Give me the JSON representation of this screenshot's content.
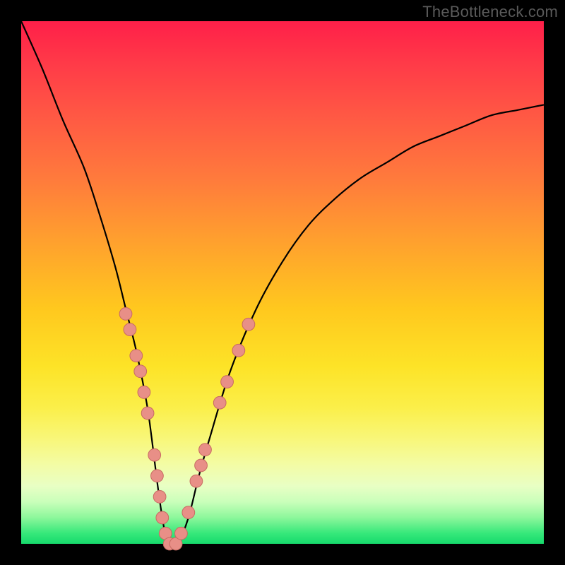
{
  "watermark": "TheBottleneck.com",
  "colors": {
    "frame": "#000000",
    "curve": "#000000",
    "marker_fill": "#e88f87",
    "marker_stroke": "#c76b62",
    "gradient_top": "#ff1f49",
    "gradient_bottom": "#16da6c"
  },
  "chart_data": {
    "type": "line",
    "title": "",
    "xlabel": "",
    "ylabel": "",
    "xlim": [
      0,
      100
    ],
    "ylim": [
      0,
      100
    ],
    "grid": false,
    "legend": false,
    "annotations": [],
    "series": [
      {
        "name": "bottleneck-curve",
        "x": [
          0,
          4,
          8,
          12,
          15,
          18,
          20,
          22,
          24,
          25,
          26,
          27,
          28,
          29,
          30,
          32,
          34,
          36,
          40,
          45,
          50,
          55,
          60,
          65,
          70,
          75,
          80,
          85,
          90,
          95,
          100
        ],
        "y": [
          100,
          91,
          81,
          72,
          63,
          53,
          45,
          37,
          27,
          20,
          12,
          5,
          0,
          0,
          0,
          5,
          13,
          20,
          33,
          45,
          54,
          61,
          66,
          70,
          73,
          76,
          78,
          80,
          82,
          83,
          84
        ]
      }
    ],
    "markers": [
      {
        "series": "bottleneck-curve",
        "x": 20.0,
        "y": 44
      },
      {
        "series": "bottleneck-curve",
        "x": 20.8,
        "y": 41
      },
      {
        "series": "bottleneck-curve",
        "x": 22.0,
        "y": 36
      },
      {
        "series": "bottleneck-curve",
        "x": 22.8,
        "y": 33
      },
      {
        "series": "bottleneck-curve",
        "x": 23.5,
        "y": 29
      },
      {
        "series": "bottleneck-curve",
        "x": 24.2,
        "y": 25
      },
      {
        "series": "bottleneck-curve",
        "x": 25.5,
        "y": 17
      },
      {
        "series": "bottleneck-curve",
        "x": 26.0,
        "y": 13
      },
      {
        "series": "bottleneck-curve",
        "x": 26.5,
        "y": 9
      },
      {
        "series": "bottleneck-curve",
        "x": 27.0,
        "y": 5
      },
      {
        "series": "bottleneck-curve",
        "x": 27.6,
        "y": 2
      },
      {
        "series": "bottleneck-curve",
        "x": 28.4,
        "y": 0
      },
      {
        "series": "bottleneck-curve",
        "x": 29.6,
        "y": 0
      },
      {
        "series": "bottleneck-curve",
        "x": 30.6,
        "y": 2
      },
      {
        "series": "bottleneck-curve",
        "x": 32.0,
        "y": 6
      },
      {
        "series": "bottleneck-curve",
        "x": 33.5,
        "y": 12
      },
      {
        "series": "bottleneck-curve",
        "x": 34.4,
        "y": 15
      },
      {
        "series": "bottleneck-curve",
        "x": 35.2,
        "y": 18
      },
      {
        "series": "bottleneck-curve",
        "x": 38.0,
        "y": 27
      },
      {
        "series": "bottleneck-curve",
        "x": 39.4,
        "y": 31
      },
      {
        "series": "bottleneck-curve",
        "x": 41.6,
        "y": 37
      },
      {
        "series": "bottleneck-curve",
        "x": 43.5,
        "y": 42
      }
    ],
    "marker_radius_pct": 1.2
  }
}
